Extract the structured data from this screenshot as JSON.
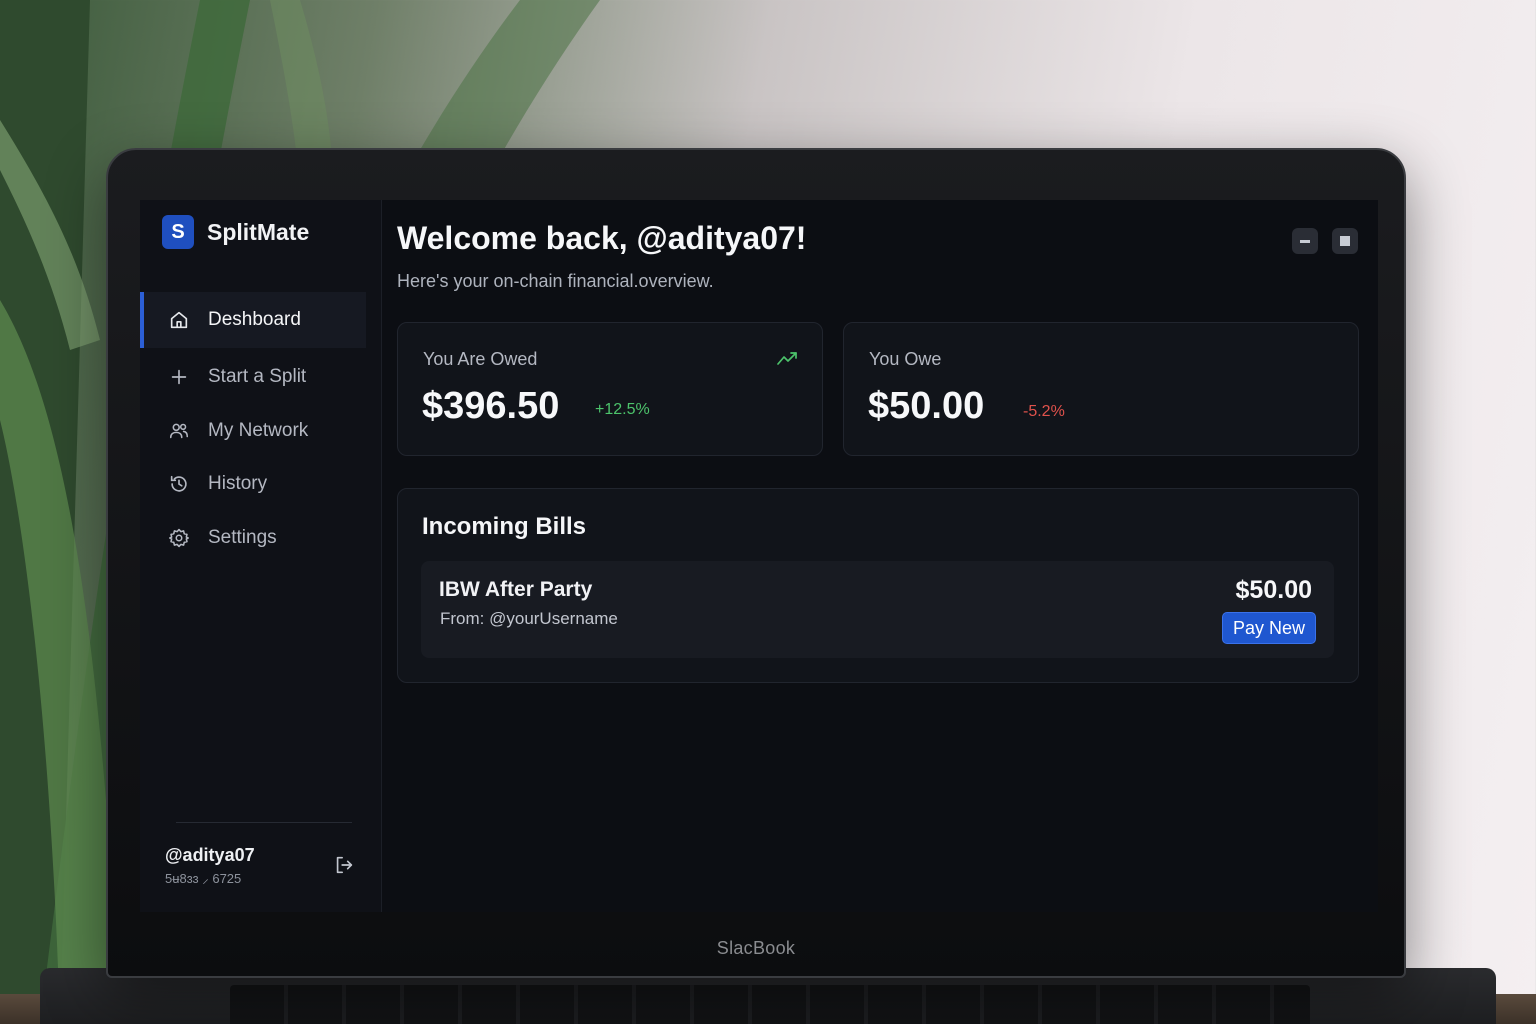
{
  "app": {
    "logo_letter": "S",
    "name": "SplitMate"
  },
  "sidebar": {
    "items": [
      {
        "label": "Deshboard",
        "icon": "home-icon",
        "active": true
      },
      {
        "label": "Start a Split",
        "icon": "plus-icon",
        "active": false
      },
      {
        "label": "My Network",
        "icon": "users-icon",
        "active": false
      },
      {
        "label": "History",
        "icon": "history-icon",
        "active": false
      },
      {
        "label": "Settings",
        "icon": "gear-icon",
        "active": false
      }
    ],
    "user": {
      "handle": "@aditya07",
      "address": "5ʉ8ɜɜ ⸝ 6725"
    }
  },
  "header": {
    "title": "Welcome back, @aditya07!",
    "subtitle": "Here's your on-chain financial.overview."
  },
  "stats": {
    "owed": {
      "label": "You Are Owed",
      "value": "$396.50",
      "delta": "+12.5%"
    },
    "owe": {
      "label": "You Owe",
      "value": "$50.00",
      "delta": "-5.2%"
    }
  },
  "bills": {
    "title": "Incoming Bills",
    "items": [
      {
        "name": "IBW After Party",
        "from": "From: @yourUsername",
        "amount": "$50.00",
        "action": "Pay New"
      }
    ]
  },
  "device": {
    "brand": "SlacBook"
  },
  "colors": {
    "accent": "#1f57d0",
    "positive": "#4cc36b",
    "negative": "#e0524c",
    "background": "#0c0e13"
  }
}
